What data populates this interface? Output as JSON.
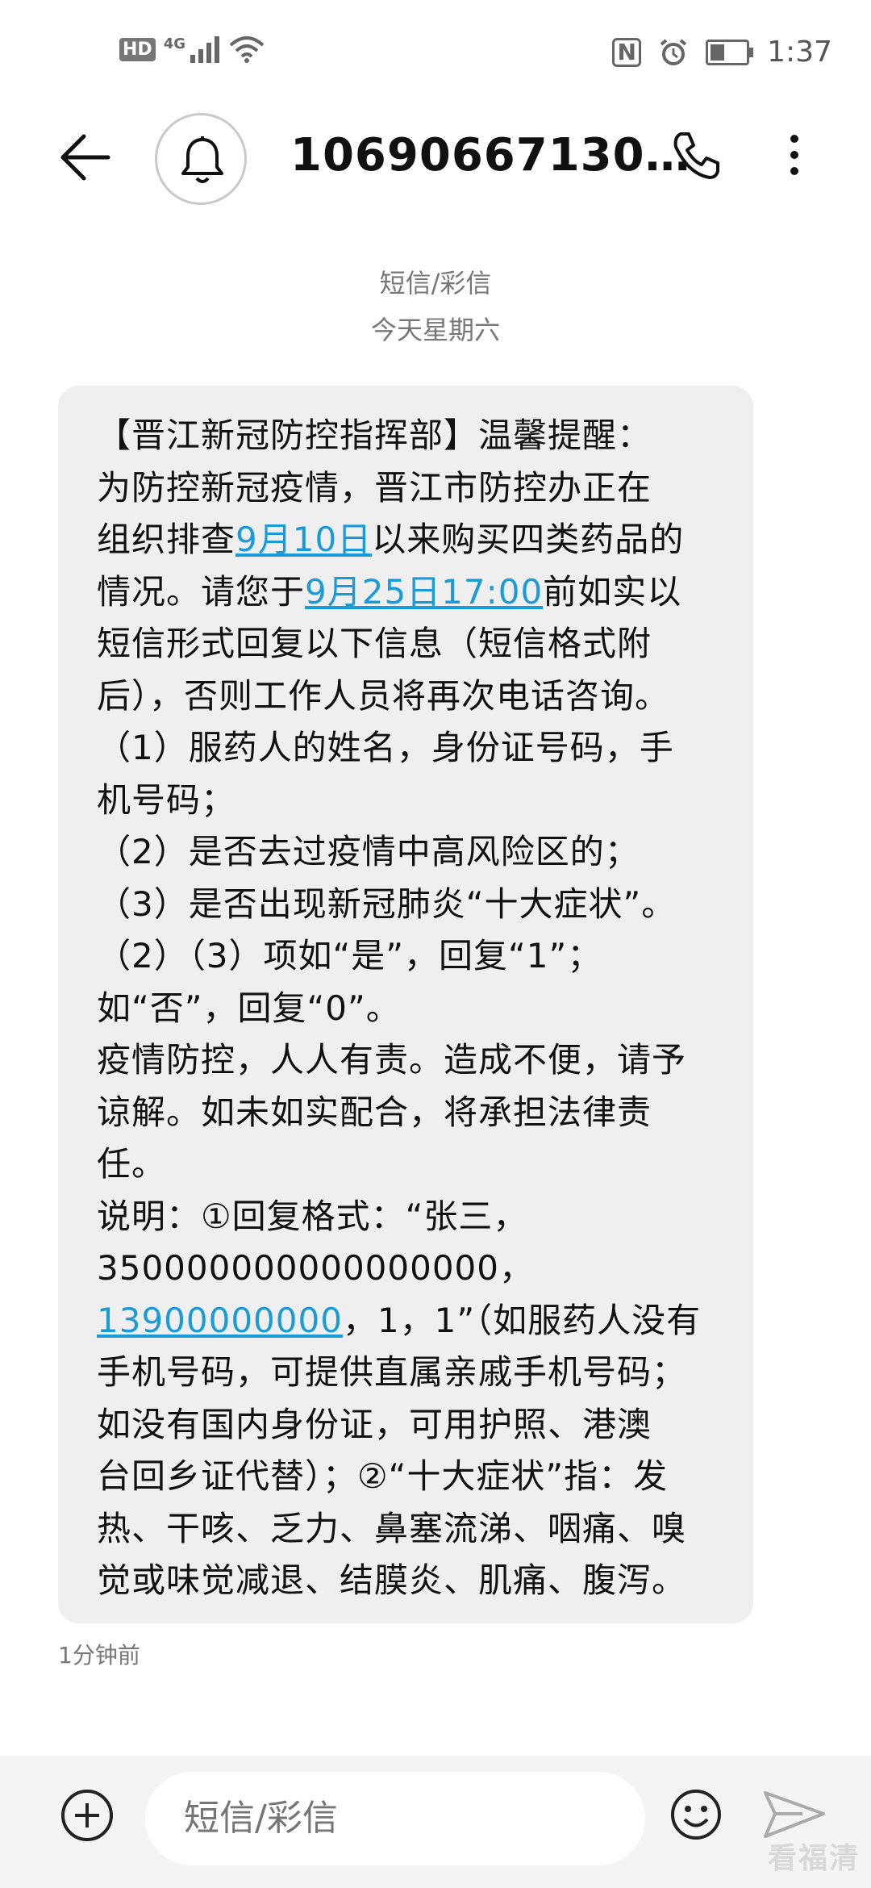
{
  "status_bar": {
    "hd_label": "HD",
    "network_label": "4G",
    "nfc_label": "N",
    "battery_level": 0.35,
    "time": "1:37"
  },
  "header": {
    "title": "10690667130…"
  },
  "thread_meta": {
    "type_label": "短信/彩信",
    "date_label": "今天星期六"
  },
  "message": {
    "segments": [
      {
        "text": "【晋江新冠防控指挥部】温馨提醒：\n为防控新冠疫情，晋江市防控办正在\n组织排查"
      },
      {
        "text": "9月10日",
        "link": true
      },
      {
        "text": "以来购买四类药品的\n情况。请您于"
      },
      {
        "text": "9月25日17:00",
        "link": true
      },
      {
        "text": "前如实以\n短信形式回复以下信息（短信格式附\n后），否则工作人员将再次电话咨询。\n（1）服药人的姓名，身份证号码，手\n机号码；\n（2）是否去过疫情中高风险区的；\n（3）是否出现新冠肺炎“十大症状”。\n（2）（3）项如“是”，回复“1”；\n如“否”，回复“0”。\n疫情防控，人人有责。造成不便，请予\n谅解。如未如实配合，将承担法律责\n任。\n说明：①回复格式：“张三，\n350000000000000000，\n"
      },
      {
        "text": "13900000000",
        "link": true
      },
      {
        "text": "，1，1”（如服药人没有\n手机号码，可提供直属亲戚手机号码；\n如没有国内身份证，可用护照、港澳\n台回乡证代替）；②“十大症状”指：发\n热、干咳、乏力、鼻塞流涕、咽痛、嗅\n觉或味觉减退、结膜炎、肌痛、腹泻。"
      }
    ],
    "timestamp": "1分钟前"
  },
  "composer": {
    "placeholder": "短信/彩信"
  },
  "watermark": "看福清",
  "colors": {
    "link": "#1a9ad6",
    "bubble": "#efefef",
    "composer_bg": "#f4f4f4"
  },
  "icons": [
    "back-arrow-icon",
    "bell-icon",
    "phone-icon",
    "more-vertical-icon",
    "add-icon",
    "emoji-icon",
    "send-icon",
    "alarm-icon",
    "wifi-icon",
    "signal-icon",
    "battery-icon",
    "nfc-icon"
  ]
}
